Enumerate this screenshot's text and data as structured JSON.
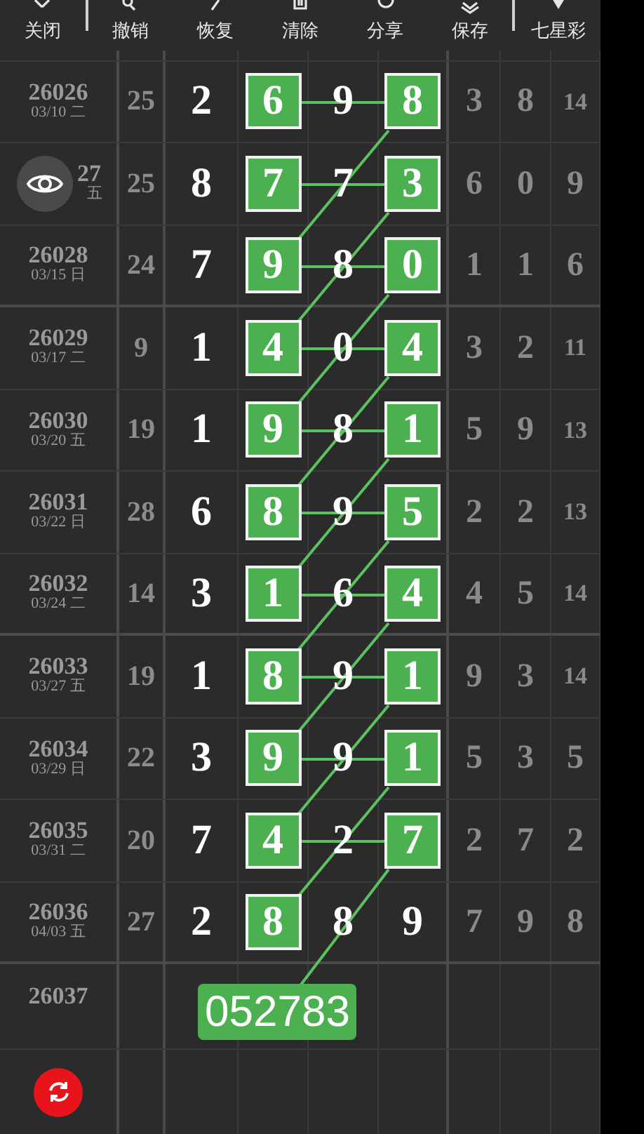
{
  "toolbar": [
    {
      "label": "关闭"
    },
    {
      "label": "撤销"
    },
    {
      "label": "恢复"
    },
    {
      "label": "清除"
    },
    {
      "label": "分享"
    },
    {
      "label": "保存"
    },
    {
      "label": "七星彩"
    }
  ],
  "rows": [
    {
      "issue": "26026",
      "date": "03/10 二",
      "sum": "25",
      "digits": [
        {
          "value": "2",
          "boxed": false
        },
        {
          "value": "6",
          "boxed": true
        },
        {
          "value": "9",
          "boxed": false
        },
        {
          "value": "8",
          "boxed": true
        }
      ],
      "extra": [
        "3",
        "8",
        "14"
      ],
      "group_end": false
    },
    {
      "issue": "27",
      "date": "五",
      "sum": "25",
      "digits": [
        {
          "value": "8",
          "boxed": false
        },
        {
          "value": "7",
          "boxed": true
        },
        {
          "value": "7",
          "boxed": false
        },
        {
          "value": "3",
          "boxed": true
        }
      ],
      "extra": [
        "6",
        "0",
        "9"
      ],
      "group_end": false
    },
    {
      "issue": "26028",
      "date": "03/15 日",
      "sum": "24",
      "digits": [
        {
          "value": "7",
          "boxed": false
        },
        {
          "value": "9",
          "boxed": true
        },
        {
          "value": "8",
          "boxed": false
        },
        {
          "value": "0",
          "boxed": true
        }
      ],
      "extra": [
        "1",
        "1",
        "6"
      ],
      "group_end": true
    },
    {
      "issue": "26029",
      "date": "03/17 二",
      "sum": "9",
      "digits": [
        {
          "value": "1",
          "boxed": false
        },
        {
          "value": "4",
          "boxed": true
        },
        {
          "value": "0",
          "boxed": false
        },
        {
          "value": "4",
          "boxed": true
        }
      ],
      "extra": [
        "3",
        "2",
        "11"
      ],
      "group_end": false
    },
    {
      "issue": "26030",
      "date": "03/20 五",
      "sum": "19",
      "digits": [
        {
          "value": "1",
          "boxed": false
        },
        {
          "value": "9",
          "boxed": true
        },
        {
          "value": "8",
          "boxed": false
        },
        {
          "value": "1",
          "boxed": true
        }
      ],
      "extra": [
        "5",
        "9",
        "13"
      ],
      "group_end": false
    },
    {
      "issue": "26031",
      "date": "03/22 日",
      "sum": "28",
      "digits": [
        {
          "value": "6",
          "boxed": false
        },
        {
          "value": "8",
          "boxed": true
        },
        {
          "value": "9",
          "boxed": false
        },
        {
          "value": "5",
          "boxed": true
        }
      ],
      "extra": [
        "2",
        "2",
        "13"
      ],
      "group_end": false
    },
    {
      "issue": "26032",
      "date": "03/24 二",
      "sum": "14",
      "digits": [
        {
          "value": "3",
          "boxed": false
        },
        {
          "value": "1",
          "boxed": true
        },
        {
          "value": "6",
          "boxed": false
        },
        {
          "value": "4",
          "boxed": true
        }
      ],
      "extra": [
        "4",
        "5",
        "14"
      ],
      "group_end": true
    },
    {
      "issue": "26033",
      "date": "03/27 五",
      "sum": "19",
      "digits": [
        {
          "value": "1",
          "boxed": false
        },
        {
          "value": "8",
          "boxed": true
        },
        {
          "value": "9",
          "boxed": false
        },
        {
          "value": "1",
          "boxed": true
        }
      ],
      "extra": [
        "9",
        "3",
        "14"
      ],
      "group_end": false
    },
    {
      "issue": "26034",
      "date": "03/29 日",
      "sum": "22",
      "digits": [
        {
          "value": "3",
          "boxed": false
        },
        {
          "value": "9",
          "boxed": true
        },
        {
          "value": "9",
          "boxed": false
        },
        {
          "value": "1",
          "boxed": true
        }
      ],
      "extra": [
        "5",
        "3",
        "5"
      ],
      "group_end": false
    },
    {
      "issue": "26035",
      "date": "03/31 二",
      "sum": "20",
      "digits": [
        {
          "value": "7",
          "boxed": false
        },
        {
          "value": "4",
          "boxed": true
        },
        {
          "value": "2",
          "boxed": false
        },
        {
          "value": "7",
          "boxed": true
        }
      ],
      "extra": [
        "2",
        "7",
        "2"
      ],
      "group_end": false
    },
    {
      "issue": "26036",
      "date": "04/03 五",
      "sum": "27",
      "digits": [
        {
          "value": "2",
          "boxed": false
        },
        {
          "value": "8",
          "boxed": true
        },
        {
          "value": "8",
          "boxed": false
        },
        {
          "value": "9",
          "boxed": false
        }
      ],
      "extra": [
        "7",
        "9",
        "8"
      ],
      "group_end": true
    }
  ],
  "prediction": {
    "issue": "26037",
    "number": "052783"
  }
}
